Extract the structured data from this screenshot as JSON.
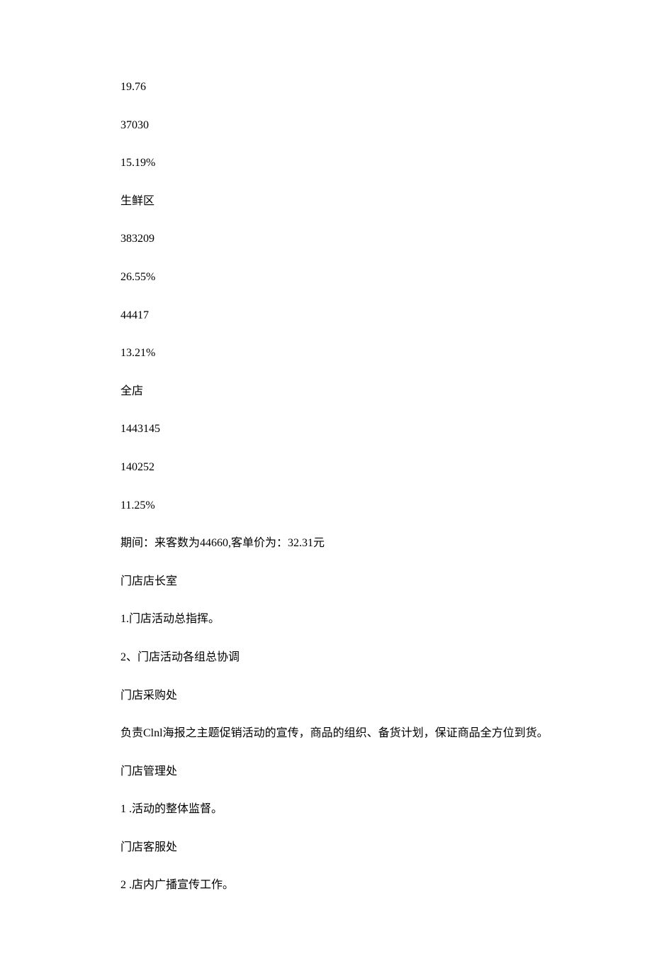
{
  "lines": {
    "l1": "19.76",
    "l2": "37030",
    "l3": "15.19%",
    "l4": "生鲜区",
    "l5": "383209",
    "l6": "26.55%",
    "l7": "44417",
    "l8": "13.21%",
    "l9": "全店",
    "l10": "1443145",
    "l11": "140252",
    "l12": "11.25%",
    "l13": "期间：来客数为44660,客单价为：32.31元",
    "l14": "门店店长室",
    "l15": "1.门店活动总指挥。",
    "l16": "2、门店活动各组总协调",
    "l17": "门店采购处",
    "l18": "负责Clnl海报之主题促销活动的宣传，商品的组织、备货计划，保证商品全方位到货。",
    "l19": "门店管理处",
    "l20": "1 .活动的整体监督。",
    "l21": "门店客服处",
    "l22": "2 .店内广播宣传工作。"
  }
}
